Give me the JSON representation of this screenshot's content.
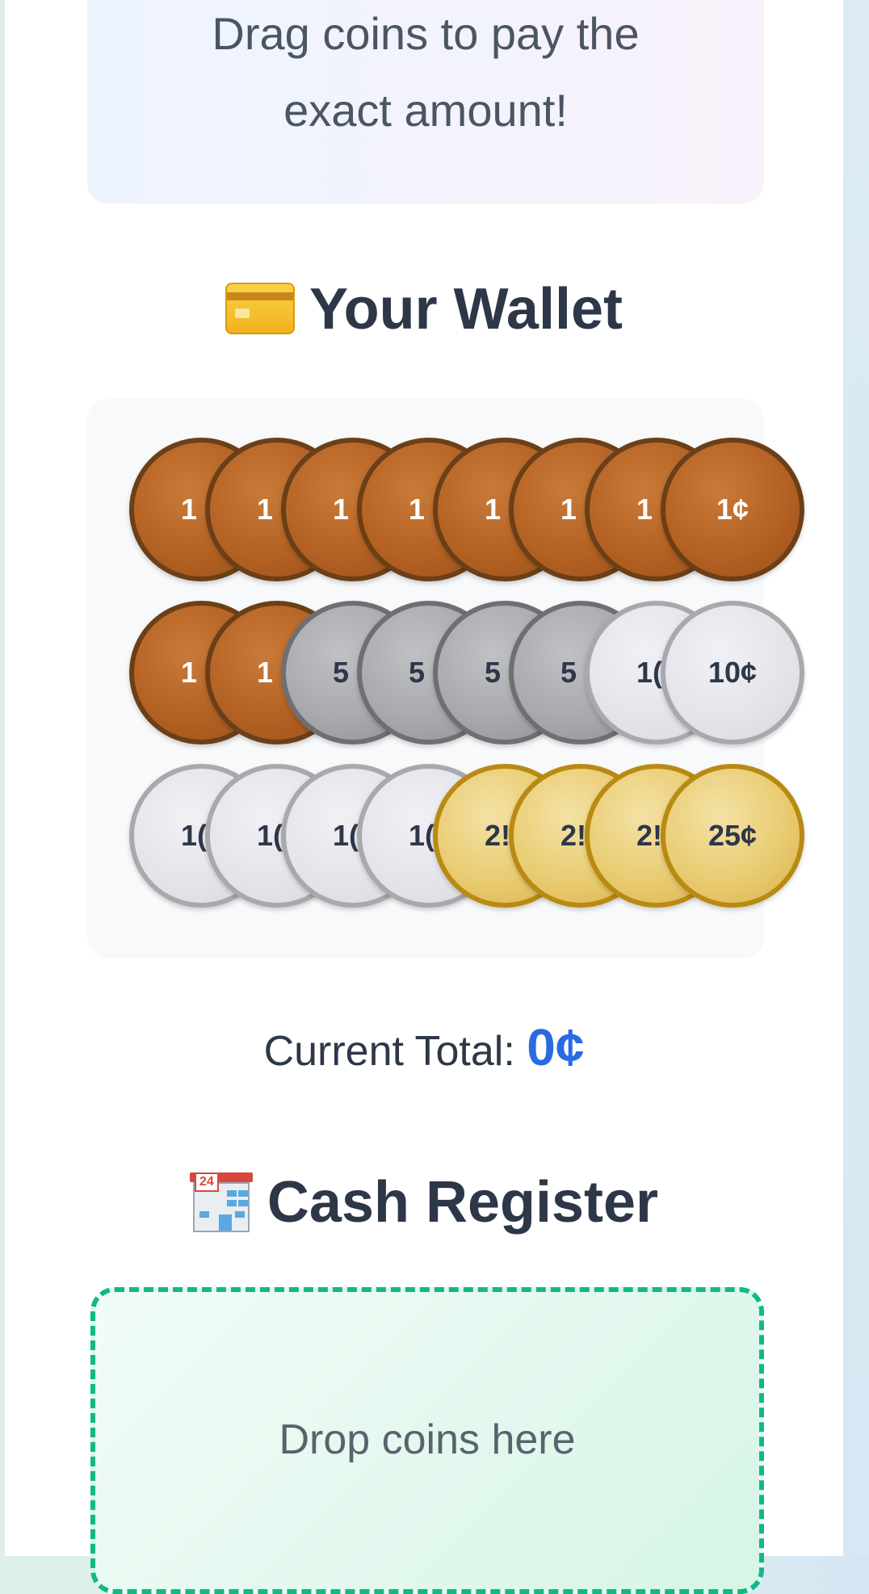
{
  "instruction": {
    "line1": "Drag coins to pay the",
    "line2": "exact amount!"
  },
  "wallet": {
    "title": "Your Wallet",
    "icon": "credit-card-icon",
    "rows": [
      [
        {
          "type": "penny",
          "label": "1",
          "value": 1
        },
        {
          "type": "penny",
          "label": "1",
          "value": 1
        },
        {
          "type": "penny",
          "label": "1",
          "value": 1
        },
        {
          "type": "penny",
          "label": "1",
          "value": 1
        },
        {
          "type": "penny",
          "label": "1",
          "value": 1
        },
        {
          "type": "penny",
          "label": "1",
          "value": 1
        },
        {
          "type": "penny",
          "label": "1",
          "value": 1
        },
        {
          "type": "penny",
          "label": "1¢",
          "value": 1
        }
      ],
      [
        {
          "type": "penny",
          "label": "1",
          "value": 1
        },
        {
          "type": "penny",
          "label": "1",
          "value": 1
        },
        {
          "type": "nickel",
          "label": "5",
          "value": 5
        },
        {
          "type": "nickel",
          "label": "5",
          "value": 5
        },
        {
          "type": "nickel",
          "label": "5",
          "value": 5
        },
        {
          "type": "nickel",
          "label": "5",
          "value": 5
        },
        {
          "type": "dime",
          "label": "1(",
          "value": 10
        },
        {
          "type": "dime",
          "label": "10¢",
          "value": 10
        }
      ],
      [
        {
          "type": "dime",
          "label": "1(",
          "value": 10
        },
        {
          "type": "dime",
          "label": "1(",
          "value": 10
        },
        {
          "type": "dime",
          "label": "1(",
          "value": 10
        },
        {
          "type": "dime",
          "label": "1(",
          "value": 10
        },
        {
          "type": "quarter",
          "label": "2!",
          "value": 25
        },
        {
          "type": "quarter",
          "label": "2!",
          "value": 25
        },
        {
          "type": "quarter",
          "label": "2!",
          "value": 25
        },
        {
          "type": "quarter",
          "label": "25¢",
          "value": 25
        }
      ]
    ]
  },
  "total": {
    "label": "Current Total:",
    "value": "0¢"
  },
  "register": {
    "title": "Cash Register",
    "icon": "convenience-store-icon",
    "sign_text": "24",
    "drop_text": "Drop coins here"
  },
  "colors": {
    "accent": "#2a6be0",
    "drop_border": "#12b886",
    "title": "#2d3748"
  }
}
